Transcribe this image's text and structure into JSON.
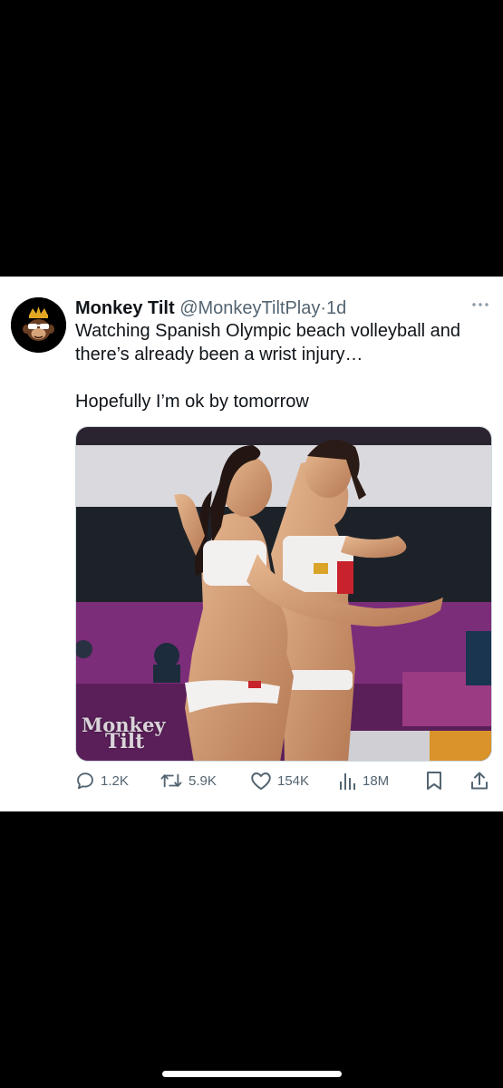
{
  "tweet": {
    "display_name": "Monkey Tilt",
    "handle": "@MonkeyTiltPlay",
    "separator": "·",
    "time": "1d",
    "text_line_1": "Watching Spanish Olympic beach volleyball and there’s already been a wrist injury…",
    "text_line_2": "Hopefully I’m ok by tomorrow",
    "media": {
      "watermark": "Monkey",
      "watermark_sub": "Tilt"
    }
  },
  "actions": {
    "replies": "1.2K",
    "reposts": "5.9K",
    "likes": "154K",
    "views": "18M"
  },
  "icons": {
    "avatar": "monkey-king-logo",
    "more": "more-dots-icon",
    "reply": "reply-icon",
    "repost": "repost-icon",
    "like": "heart-icon",
    "views": "views-bar-chart-icon",
    "bookmark": "bookmark-icon",
    "share": "share-icon"
  },
  "colors": {
    "text_primary": "#0f1419",
    "text_secondary": "#536471",
    "background_letterbox": "#000000",
    "card_background": "#ffffff"
  }
}
